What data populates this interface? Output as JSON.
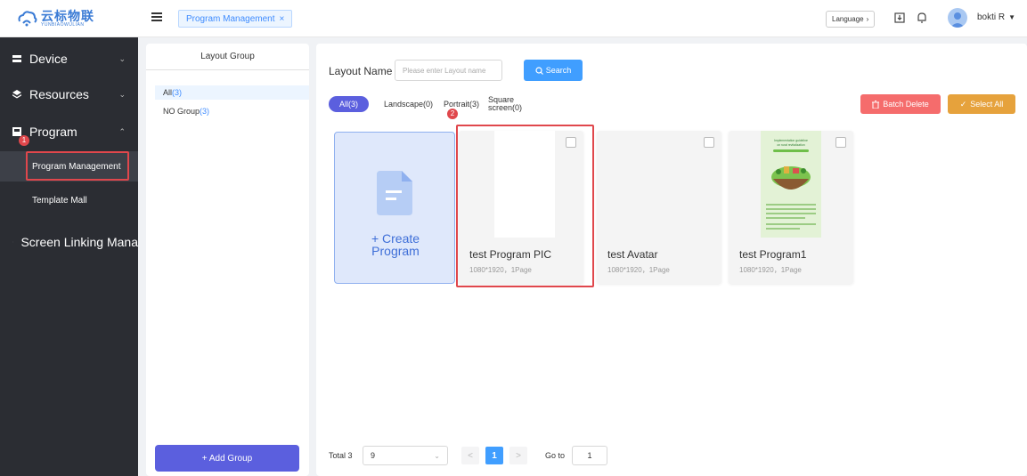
{
  "brand": {
    "name_cn": "云标物联",
    "name_en": "YUNBIAOWULIAN"
  },
  "sidebar": {
    "items": [
      {
        "label": "Device"
      },
      {
        "label": "Resources"
      },
      {
        "label": "Program"
      },
      {
        "label": "Screen Linking Mana"
      }
    ],
    "sub_items": [
      {
        "label": "Program Management"
      },
      {
        "label": "Template Mall"
      }
    ]
  },
  "header": {
    "tab": "Program Management",
    "language": "Language",
    "user": "bokti R"
  },
  "group_panel": {
    "title": "Layout Group",
    "groups": [
      {
        "label": "All",
        "count": "(3)"
      },
      {
        "label": "NO Group",
        "count": "(3)"
      }
    ],
    "add_button": "+ Add Group"
  },
  "main": {
    "search": {
      "label": "Layout Name",
      "placeholder": "Please enter Layout name",
      "button": "Search"
    },
    "filters": [
      {
        "label": "All(3)"
      },
      {
        "label": "Landscape(0)"
      },
      {
        "label": "Portrait(3)"
      },
      {
        "label": "Square",
        "label2": "screen(0)"
      }
    ],
    "batch_delete": "Batch Delete",
    "select_all": "Select All",
    "create_card": {
      "line1": "+ Create",
      "line2": "Program"
    },
    "programs": [
      {
        "name": "test Program PIC",
        "meta": "1080*1920，1Page"
      },
      {
        "name": "test Avatar",
        "meta": "1080*1920，1Page"
      },
      {
        "name": "test Program1",
        "meta": "1080*1920，1Page"
      }
    ],
    "poster": {
      "title1": "Implementation guideline",
      "title2": "on rural revitalization"
    }
  },
  "pagination": {
    "total": "Total 3",
    "page_size": "9",
    "prev": "<",
    "current": "1",
    "next": ">",
    "goto_label": "Go to",
    "goto_value": "1"
  },
  "annotations": {
    "step1": "1",
    "step2": "2"
  },
  "colors": {
    "sidebar_bg": "#2b2d33",
    "primary": "#409eff",
    "accent_purple": "#5b5fde",
    "danger": "#f56c6c",
    "warning": "#e6a23c",
    "highlight_red": "#e0474c"
  }
}
